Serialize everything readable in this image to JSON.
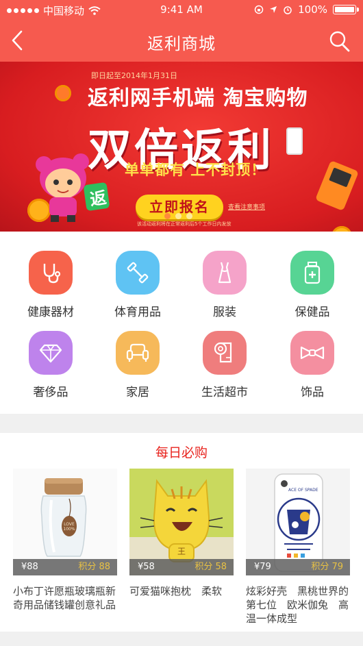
{
  "status_bar": {
    "carrier": "中国移动",
    "time": "9:41 AM",
    "battery": "100%"
  },
  "nav": {
    "title": "返利商城",
    "back_icon": "chevron-left-icon",
    "search_icon": "search-icon"
  },
  "banner": {
    "date": "即日起至2014年1月31日",
    "line1": "返利网手机端 淘宝购物",
    "line2": "双倍返利",
    "line3": "单单都有 上不封顶！",
    "cta": "立即报名",
    "rules": "查看注意事项",
    "footnote": "该活动返利将在正常返利后5个工作日内发放",
    "mascot_badge": "返",
    "slide_count": 3,
    "active_slide": 0
  },
  "categories": [
    {
      "label": "健康器材",
      "icon": "stethoscope-icon",
      "color": "#f6634b"
    },
    {
      "label": "体育用品",
      "icon": "dumbbell-icon",
      "color": "#5fc3f3"
    },
    {
      "label": "服装",
      "icon": "dress-icon",
      "color": "#f5a3c9"
    },
    {
      "label": "保健品",
      "icon": "medicine-bottle-icon",
      "color": "#57d494"
    },
    {
      "label": "奢侈品",
      "icon": "diamond-icon",
      "color": "#be83ec"
    },
    {
      "label": "家居",
      "icon": "sofa-icon",
      "color": "#f6b95a"
    },
    {
      "label": "生活超市",
      "icon": "toilet-paper-icon",
      "color": "#ef7d7d"
    },
    {
      "label": "饰品",
      "icon": "bow-tie-icon",
      "color": "#f48fa0"
    }
  ],
  "daily": {
    "title": "每日必购",
    "products": [
      {
        "price": "¥88",
        "points": "积分 88",
        "name": "小布丁许愿瓶玻璃瓶新奇用品储钱罐创意礼品",
        "jar_tag": "LOVE 100%"
      },
      {
        "price": "¥58",
        "points": "积分 58",
        "name": "可爱猫咪抱枕　柔软",
        "pillow_mark": "王"
      },
      {
        "price": "¥79",
        "points": "积分 79",
        "name": "炫彩好壳　黑桃世界的第七位　欧米伽兔　高温一体成型",
        "case_print": "ACE OF SPADE"
      }
    ]
  }
}
